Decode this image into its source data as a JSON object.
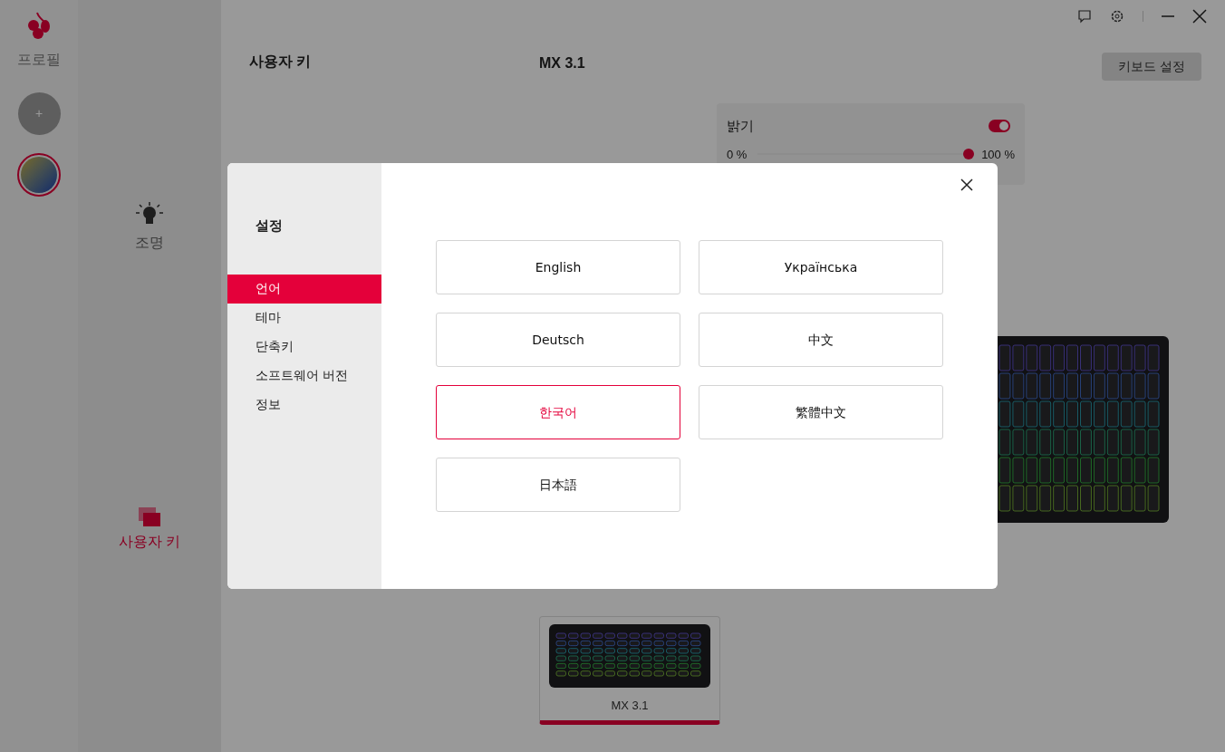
{
  "sidebar": {
    "title": "프로필",
    "profiles": [
      {
        "kind": "add",
        "label": "+",
        "selected": false
      },
      {
        "kind": "profile",
        "selected": true
      }
    ]
  },
  "nav": [
    {
      "label": "조명",
      "kind": "bulb",
      "selected": false
    },
    {
      "label": "사용자 키",
      "kind": "keys",
      "selected": true
    }
  ],
  "panel": {
    "title": "사용자 키"
  },
  "device": {
    "title": "MX 3.1",
    "settings_button": "키보드 설정",
    "brightness": {
      "label": "밝기",
      "on": true,
      "min": "0 %",
      "max": "100 %",
      "level": 1
    },
    "cards": [
      {
        "name": "MX 3.1",
        "selected": true
      }
    ]
  },
  "dialog": {
    "title": "설정",
    "menu": [
      {
        "label": "언어",
        "selected": true
      },
      {
        "label": "테마",
        "selected": false
      },
      {
        "label": "단축키",
        "selected": false
      },
      {
        "label": "소프트웨어 버전",
        "selected": false
      },
      {
        "label": "정보",
        "selected": false
      }
    ],
    "languages": [
      {
        "label": "English",
        "selected": false
      },
      {
        "label": "Українська",
        "selected": false
      },
      {
        "label": "Deutsch",
        "selected": false
      },
      {
        "label": "中文",
        "selected": false
      },
      {
        "label": "한국어",
        "selected": true
      },
      {
        "label": "繁體中文",
        "selected": false
      },
      {
        "label": "日本語",
        "selected": false
      }
    ]
  }
}
